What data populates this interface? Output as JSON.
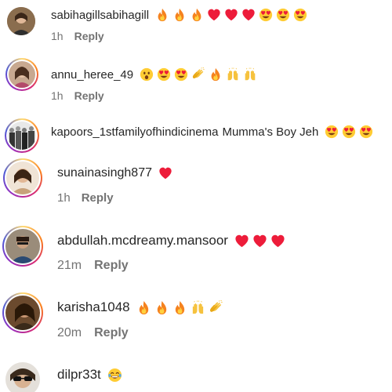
{
  "comments": [
    {
      "username": "sabihagillsabihagill",
      "text": "",
      "time": "1h",
      "reply": "Reply",
      "emojis": [
        "fire",
        "fire",
        "fire",
        "heart",
        "heart",
        "heart",
        "heart-eyes",
        "heart-eyes",
        "heart-eyes"
      ],
      "avatar_color": "#8a6d4e",
      "ring": false
    },
    {
      "username": "annu_heree_49",
      "text": "",
      "time": "1h",
      "reply": "Reply",
      "emojis": [
        "astonished",
        "heart-eyes",
        "heart-eyes",
        "clap",
        "fire",
        "raised-hands",
        "raised-hands"
      ],
      "avatar_color": "#c8a890",
      "ring": true
    },
    {
      "username": "kapoors_1stfamilyofhindicinema",
      "text": "Mumma's Boy Jeh",
      "time": "",
      "reply": "",
      "emojis": [
        "heart-eyes",
        "heart-eyes",
        "heart-eyes"
      ],
      "avatar_color": "#555555",
      "ring": true
    },
    {
      "username": "sunainasingh877",
      "text": "",
      "time": "1h",
      "reply": "Reply",
      "emojis": [
        "heart"
      ],
      "avatar_color": "#d4b89a",
      "ring": true
    },
    {
      "username": "abdullah.mcdreamy.mansoor",
      "text": "",
      "time": "21m",
      "reply": "Reply",
      "emojis": [
        "heart",
        "heart",
        "heart"
      ],
      "avatar_color": "#9a8c7a",
      "ring": true
    },
    {
      "username": "karisha1048",
      "text": "",
      "time": "20m",
      "reply": "Reply",
      "emojis": [
        "fire",
        "fire",
        "fire",
        "raised-hands",
        "clap"
      ],
      "avatar_color": "#6b4a2e",
      "ring": true
    },
    {
      "username": "dilpr33t",
      "text": "",
      "time": "",
      "reply": "",
      "emojis": [
        "joy"
      ],
      "avatar_color": "#5a4636",
      "ring": false
    }
  ],
  "colors": {
    "text": "#262626",
    "muted": "#737373",
    "heart": "#ed1c3a",
    "fire": "#f5821f",
    "emoji_face": "#ffcc33"
  }
}
